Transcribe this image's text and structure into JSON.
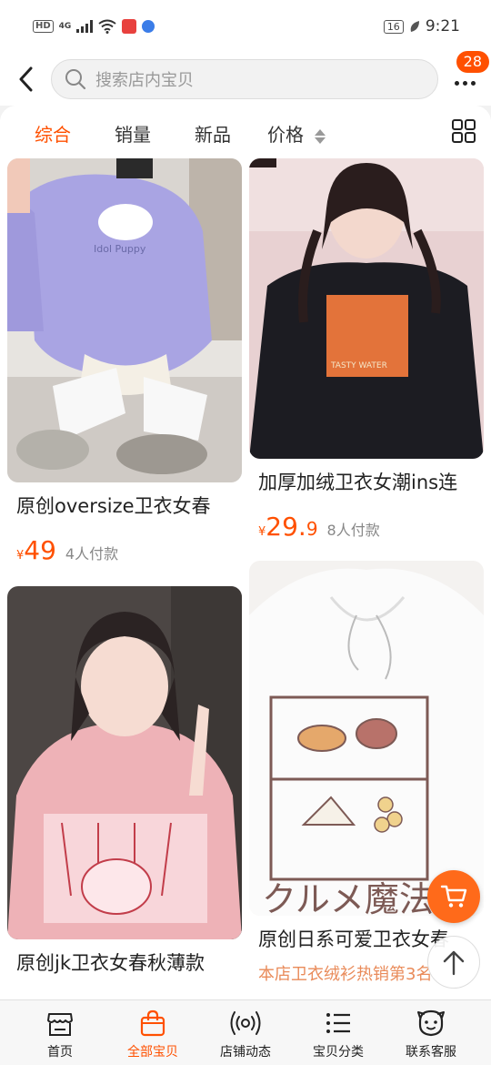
{
  "status_bar": {
    "hd": "HD",
    "network": "4G",
    "battery": "16",
    "time": "9:21"
  },
  "top_bar": {
    "search_placeholder": "搜索店内宝贝",
    "notification_count": "28"
  },
  "sort_tabs": [
    {
      "label": "综合",
      "active": true
    },
    {
      "label": "销量",
      "active": false
    },
    {
      "label": "新品",
      "active": false
    },
    {
      "label": "价格",
      "active": false
    }
  ],
  "products": [
    {
      "title": "原创oversize卫衣女春",
      "price_symbol": "¥",
      "price_int": "49",
      "price_dec": "",
      "sold": "4人付款"
    },
    {
      "title": "加厚加绒卫衣女潮ins连",
      "price_symbol": "¥",
      "price_int": "29.",
      "price_dec": "9",
      "sold": "8人付款"
    },
    {
      "title": "原创jk卫衣女春秋薄款",
      "price_symbol": "",
      "price_int": "",
      "price_dec": "",
      "sold": ""
    },
    {
      "title": "原创日系可爱卫衣女春",
      "promo": "本店卫衣绒衫热销第3名",
      "price_symbol": "",
      "price_int": "",
      "price_dec": "",
      "sold": ""
    }
  ],
  "image_text": {
    "p1": "Idol Puppy",
    "p2": "TASTY WATER",
    "p4": "クルメ魔法"
  },
  "bottom_nav": [
    {
      "label": "首页",
      "active": false
    },
    {
      "label": "全部宝贝",
      "active": true
    },
    {
      "label": "店铺动态",
      "active": false
    },
    {
      "label": "宝贝分类",
      "active": false
    },
    {
      "label": "联系客服",
      "active": false
    }
  ],
  "colors": {
    "accent": "#ff5000",
    "promo": "#e98b5a"
  }
}
